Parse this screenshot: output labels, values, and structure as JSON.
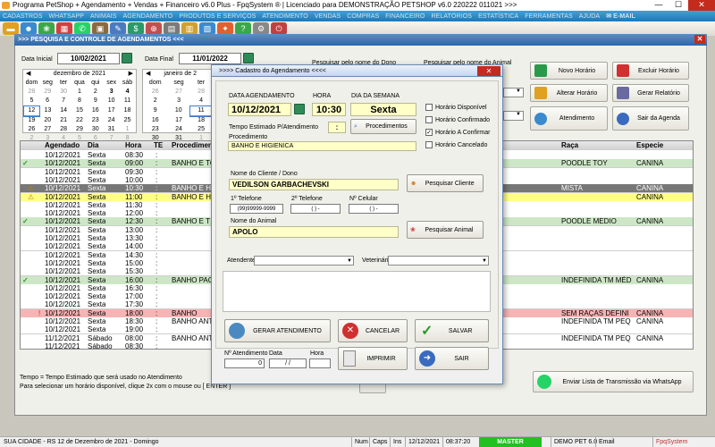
{
  "app": {
    "title": "Programa PetShop + Agendamento + Vendas + Financeiro v6.0 Plus - FpqSystem ® | Licenciado para  DEMONSTRAÇÃO PETSHOP v6.0 220222 011021 >>>",
    "min": "—",
    "max": "☐",
    "close": "✕"
  },
  "menu": [
    "CADASTROS",
    "WHATSAPP",
    "ANIMAIS",
    "AGENDAMENTO",
    "PRODUTOS E SERVIÇOS",
    "ATENDIMENTO",
    "VENDAS",
    "COMPRAS",
    "FINANCEIRO",
    "RELATÓRIOS",
    "ESTATÍSTICA",
    "FERRAMENTAS",
    "AJUDA"
  ],
  "menu_email": "E-MAIL",
  "main": {
    "header": ">>>  PESQUISA E CONTROLE DE AGENDAMENTOS  <<<",
    "data_inicial_label": "Data Inicial",
    "data_inicial": "10/02/2021",
    "data_final_label": "Data Final",
    "data_final": "11/01/2022",
    "pesq_dono": "Pesquisar pelo nome do Dono",
    "pesq_animal": "Pesquisar pelo nome do Animal",
    "cal1": {
      "month": "dezembro de 2021",
      "days": [
        "dom",
        "seg",
        "ter",
        "qua",
        "qui",
        "sex",
        "sáb"
      ],
      "rows": [
        [
          "28",
          "29",
          "30",
          "1",
          "2",
          "3",
          "4"
        ],
        [
          "5",
          "6",
          "7",
          "8",
          "9",
          "10",
          "11"
        ],
        [
          "12",
          "13",
          "14",
          "15",
          "16",
          "17",
          "18"
        ],
        [
          "19",
          "20",
          "21",
          "22",
          "23",
          "24",
          "25"
        ],
        [
          "26",
          "27",
          "28",
          "29",
          "30",
          "31",
          "1"
        ],
        [
          "2",
          "3",
          "4",
          "5",
          "6",
          "7",
          "8"
        ]
      ]
    },
    "cal2": {
      "month": "janeiro de 2",
      "days": [
        "dom",
        "seg",
        "ter"
      ],
      "rows": [
        [
          "26",
          "27",
          "28"
        ],
        [
          "2",
          "3",
          "4"
        ],
        [
          "9",
          "10",
          "11"
        ],
        [
          "16",
          "17",
          "18"
        ],
        [
          "23",
          "24",
          "25"
        ],
        [
          "30",
          "31",
          "1"
        ]
      ]
    },
    "buttons": {
      "novo": "Novo Horário",
      "excluir": "Excluir Horário",
      "alterar": "Alterar Horário",
      "relatorio": "Gerar Relatório",
      "atendimento": "Atendimento",
      "sair": "Sair da Agenda"
    },
    "grid_headers": {
      "agendado": "Agendado",
      "dia": "Dia",
      "hora": "Hora",
      "te": "TE",
      "proc": "Procedimen",
      "raca": "Raça",
      "especie": "Especie"
    },
    "rows": [
      {
        "c": "white",
        "ck": "",
        "date": "10/12/2021",
        "dia": "Sexta",
        "hora": "08:30",
        "proc": "",
        "raca": "",
        "esp": ""
      },
      {
        "c": "green",
        "ck": "✓",
        "date": "10/12/2021",
        "dia": "Sexta",
        "hora": "09:00",
        "proc": "BANHO E TO",
        "raca": "POODLE TOY",
        "esp": "CANINA"
      },
      {
        "c": "white",
        "ck": "",
        "date": "10/12/2021",
        "dia": "Sexta",
        "hora": "09:30",
        "proc": "",
        "raca": "",
        "esp": ""
      },
      {
        "c": "white",
        "ck": "",
        "date": "10/12/2021",
        "dia": "Sexta",
        "hora": "10:00",
        "proc": "",
        "raca": "",
        "esp": ""
      },
      {
        "c": "dark",
        "ck": "⚠",
        "date": "10/12/2021",
        "dia": "Sexta",
        "hora": "10:30",
        "proc": "BANHO E H",
        "raca": "MISTA",
        "esp": "CANINA"
      },
      {
        "c": "yellow",
        "ck": "⚠",
        "date": "10/12/2021",
        "dia": "Sexta",
        "hora": "11:00",
        "proc": "BANHO E H",
        "raca": "",
        "esp": "CANINA"
      },
      {
        "c": "white",
        "ck": "",
        "date": "10/12/2021",
        "dia": "Sexta",
        "hora": "11:30",
        "proc": "",
        "raca": "",
        "esp": ""
      },
      {
        "c": "white",
        "ck": "",
        "date": "10/12/2021",
        "dia": "Sexta",
        "hora": "12:00",
        "proc": "",
        "raca": "",
        "esp": ""
      },
      {
        "c": "green",
        "ck": "✓",
        "date": "10/12/2021",
        "dia": "Sexta",
        "hora": "12:30",
        "proc": "BANHO E T",
        "raca": "POODLE MEDIO",
        "esp": "CANINA"
      },
      {
        "c": "white",
        "ck": "",
        "date": "10/12/2021",
        "dia": "Sexta",
        "hora": "13:00",
        "proc": "",
        "raca": "",
        "esp": ""
      },
      {
        "c": "white",
        "ck": "",
        "date": "10/12/2021",
        "dia": "Sexta",
        "hora": "13:30",
        "proc": "",
        "raca": "",
        "esp": ""
      },
      {
        "c": "white",
        "ck": "",
        "date": "10/12/2021",
        "dia": "Sexta",
        "hora": "14:00",
        "proc": "",
        "raca": "",
        "esp": ""
      },
      {
        "c": "white",
        "ck": "",
        "date": "10/12/2021",
        "dia": "Sexta",
        "hora": "14:30",
        "proc": "",
        "raca": "",
        "esp": ""
      },
      {
        "c": "white",
        "ck": "",
        "date": "10/12/2021",
        "dia": "Sexta",
        "hora": "15:00",
        "proc": "",
        "raca": "",
        "esp": ""
      },
      {
        "c": "white",
        "ck": "",
        "date": "10/12/2021",
        "dia": "Sexta",
        "hora": "15:30",
        "proc": "",
        "raca": "",
        "esp": ""
      },
      {
        "c": "green",
        "ck": "✓",
        "date": "10/12/2021",
        "dia": "Sexta",
        "hora": "16:00",
        "proc": "BANHO PAC",
        "raca": "INDEFINIDA TM MÉD",
        "esp": "CANINA"
      },
      {
        "c": "white",
        "ck": "",
        "date": "10/12/2021",
        "dia": "Sexta",
        "hora": "16:30",
        "proc": "",
        "raca": "",
        "esp": ""
      },
      {
        "c": "white",
        "ck": "",
        "date": "10/12/2021",
        "dia": "Sexta",
        "hora": "17:00",
        "proc": "",
        "raca": "",
        "esp": ""
      },
      {
        "c": "white",
        "ck": "",
        "date": "10/12/2021",
        "dia": "Sexta",
        "hora": "17:30",
        "proc": "",
        "raca": "",
        "esp": ""
      },
      {
        "c": "pink",
        "ck": "!",
        "date": "10/12/2021",
        "dia": "Sexta",
        "hora": "18:00",
        "proc": "BANHO",
        "raca": "SEM RAÇAS DEFINI",
        "esp": "CANINA"
      },
      {
        "c": "white",
        "ck": "",
        "date": "10/12/2021",
        "dia": "Sexta",
        "hora": "18:30",
        "proc": "BANHO ANT",
        "raca": "INDEFINIDA TM PEQ",
        "esp": "CANINA"
      },
      {
        "c": "white",
        "ck": "",
        "date": "10/12/2021",
        "dia": "Sexta",
        "hora": "19:00",
        "proc": "",
        "raca": "",
        "esp": ""
      },
      {
        "c": "white",
        "ck": "",
        "date": "11/12/2021",
        "dia": "Sábado",
        "hora": "08:00",
        "proc": "BANHO ANT",
        "raca": "INDEFINIDA TM PEQ",
        "esp": "CANINA"
      },
      {
        "c": "white",
        "ck": "",
        "date": "11/12/2021",
        "dia": "Sábado",
        "hora": "08:30",
        "proc": "",
        "raca": "",
        "esp": ""
      }
    ],
    "footer1": "Tempo = Tempo Estimado que será usado no Atendimento",
    "footer2": "Para selecionar um horário disponível, clique 2x com o mouse ou [ ENTER ]",
    "whatsapp_btn": "Enviar Lista de Transmissão via WhatsApp"
  },
  "dialog": {
    "title": ">>>>  Cadastro do Agendamento  <<<<",
    "data_label": "DATA AGENDAMENTO",
    "data": "10/12/2021",
    "hora_label": "HORA",
    "hora": "10:30",
    "dia_label": "DIA DA SEMANA",
    "dia": "Sexta",
    "chk_disp": "Horário Disponível",
    "chk_conf": "Horário Confirmado",
    "chk_aconf": "Horário A Confirmar",
    "chk_canc": "Horário Cancelado",
    "tempo_label": "Tempo Estimado P/Atendimento",
    "tempo": ":",
    "procedimentos_btn": "Procedimentos",
    "proc_label": "Procedimento",
    "proc": "BANHO E HIGIENICA",
    "cliente_label": "Nome do Cliente / Dono",
    "cliente": "VEDILSON GARBACHEVSKI",
    "pesq_cliente_btn": "Pesquisar Cliente",
    "tel1_label": "1º Telefone",
    "tel1": "(99)99999-9999",
    "tel2_label": "2º Telefone",
    "tel2": "(   )   -",
    "cel_label": "Nº Celular",
    "cel": "(   )   -",
    "animal_label": "Nome do Animal",
    "animal": "APOLO",
    "pesq_animal_btn": "Pesquisar Animal",
    "atendente_label": "Atendente",
    "veterinario_label": "Veterinário",
    "gerar_btn": "GERAR ATENDIMENTO",
    "cancelar_btn": "CANCELAR",
    "salvar_btn": "SALVAR",
    "natend_label": "Nº Atendimento",
    "natend": "0",
    "data2_label": "Data",
    "data2": "/   /",
    "hora2_label": "Hora",
    "imprimir_btn": "IMPRIMIR",
    "sair_btn": "SAIR"
  },
  "statusbar": {
    "left": "SUA CIDADE - RS 12 de Dezembro de 2021 - Domingo",
    "num": "Num",
    "caps": "Caps",
    "ins": "Ins",
    "date": "12/12/2021",
    "time": "08:37:20",
    "master": "MASTER",
    "demo": "DEMO PET 6.0",
    "email": "Email",
    "brand": "FpqSystem"
  }
}
